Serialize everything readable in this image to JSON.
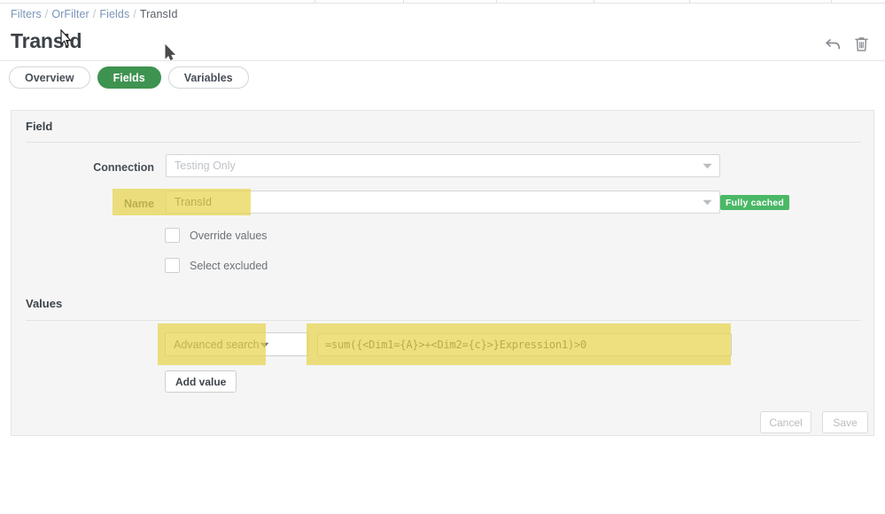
{
  "breadcrumb": {
    "items": [
      {
        "label": "Filters",
        "link": true
      },
      {
        "label": "OrFilter",
        "link": true
      },
      {
        "label": "Fields",
        "link": true
      },
      {
        "label": "TransId",
        "link": false
      }
    ],
    "separator": "/"
  },
  "header": {
    "title": "TransId",
    "undo_icon": "undo-arrow-icon",
    "delete_icon": "trash-icon"
  },
  "tabs": [
    {
      "label": "Overview",
      "active": false
    },
    {
      "label": "Fields",
      "active": true
    },
    {
      "label": "Variables",
      "active": false
    }
  ],
  "field_section": {
    "heading": "Field",
    "connection": {
      "label": "Connection",
      "value": "",
      "placeholder": "Testing Only"
    },
    "name": {
      "label": "Name",
      "value": "TransId",
      "placeholder": ""
    },
    "cache_badge": "Fully cached",
    "checkboxes": [
      {
        "label": "Override values",
        "checked": false
      },
      {
        "label": "Select excluded",
        "checked": false
      }
    ]
  },
  "values_section": {
    "heading": "Values",
    "search_mode": "Advanced search",
    "expression": "=sum({<Dim1={A}>+<Dim2={c}>}Expression1)>0",
    "add_value_label": "Add value"
  },
  "footer": {
    "cancel_label": "Cancel",
    "save_label": "Save"
  },
  "colors": {
    "accent_green": "#3f9350",
    "badge_green": "#4ab866",
    "highlight_yellow": "#e8d44d",
    "link_blue": "#7a93b8"
  }
}
